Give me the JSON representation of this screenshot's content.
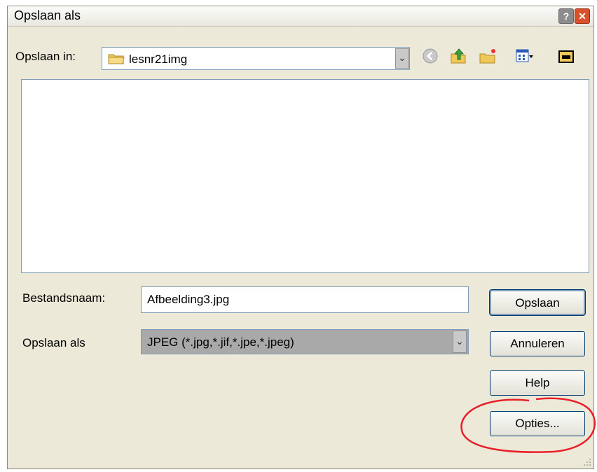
{
  "window": {
    "title": "Opslaan als"
  },
  "location": {
    "label": "Opslaan in:",
    "folder": "lesnr21img"
  },
  "filename": {
    "label": "Bestandsnaam:",
    "value": "Afbeelding3.jpg"
  },
  "filetype": {
    "label": "Opslaan als",
    "value": "JPEG  (*.jpg,*.jif,*.jpe,*.jpeg)"
  },
  "buttons": {
    "save": "Opslaan",
    "cancel": "Annuleren",
    "help": "Help",
    "options": "Opties..."
  },
  "title_buttons": {
    "help": "?",
    "close": "✕"
  },
  "dropdown_glyph": "⌄",
  "colors": {
    "annotation": "#e8202a",
    "folder": "#f0c85a",
    "up_arrow": "#3aa23a"
  }
}
